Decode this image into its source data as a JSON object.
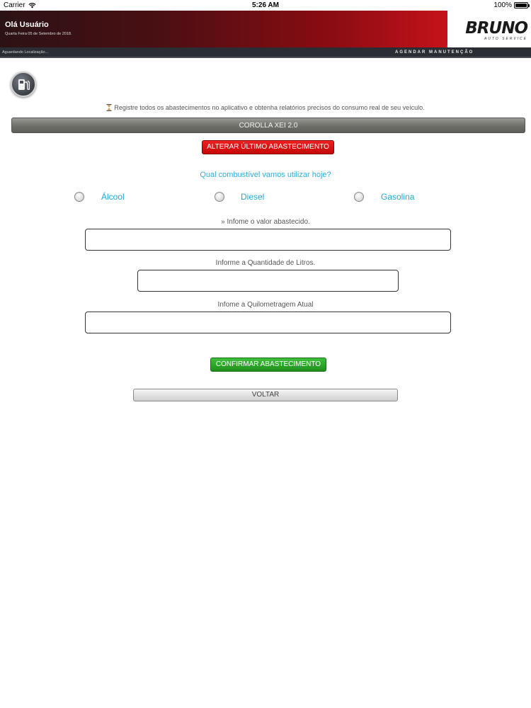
{
  "status_bar": {
    "carrier": "Carrier",
    "time": "5:26 AM",
    "battery": "100%"
  },
  "header": {
    "greeting": "Olá Usuário",
    "date": "Quarta Feira 05 de Setembro de 2018.",
    "logo_text": "BRUNO",
    "logo_sub": "AUTO SERVICE"
  },
  "subbar": {
    "location_status": "Aguardando Localização...",
    "schedule_link": "AGENDAR MANUTENÇÃO"
  },
  "info_text": "Registre todos os abastecimentos no aplicativo e obtenha relatórios precisos do consumo real de seu veículo.",
  "vehicle": "COROLLA XEI 2.0",
  "buttons": {
    "alter_last": "ALTERAR ÚLTIMO ABASTECIMENTO",
    "confirm": "CONFIRMAR ABASTECIMENTO",
    "back": "VOLTAR"
  },
  "question": "Qual combustível vamos utilizar hoje?",
  "fuel_options": [
    "Álcool",
    "Diesel",
    "Gasolina"
  ],
  "fields": {
    "value_label": "» Infome o valor abastecido.",
    "value": "",
    "liters_label": "Informe a Quantidade de Litros.",
    "liters": "",
    "km_label": "Infome a Quilometragem Atual",
    "km": ""
  },
  "colors": {
    "accent_blue": "#2eaee0",
    "red_button": "#d41212",
    "green_button": "#2aa826",
    "header_red": "#c4121a"
  }
}
